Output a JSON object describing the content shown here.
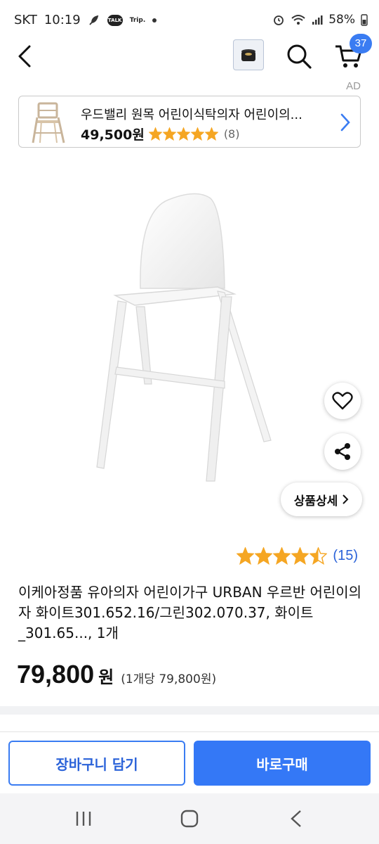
{
  "status_bar": {
    "carrier": "SKT",
    "time": "10:19",
    "talk_label": "TALK",
    "trip_label": "Trip.",
    "battery": "58%"
  },
  "header": {
    "icons": [
      "back-arrow-icon",
      "product-thumbnail",
      "search-icon",
      "cart-icon"
    ],
    "cart_count": "37"
  },
  "ad": {
    "label": "AD",
    "title": "우드밸리 원목 어린이식탁의자 어린이의...",
    "price": "49,500원",
    "rating_stars": 5,
    "review_count": "(8)"
  },
  "product": {
    "actions": {
      "like_icon": "heart-icon",
      "share_icon": "share-icon",
      "detail_label": "상품상세"
    },
    "rating": 4.5,
    "review_count": "(15)",
    "title": "이케아정품 유아의자 어린이가구 URBAN 우르반 어린이의자 화이트301.652.16/그린302.070.37, 화이트_301.65..., 1개",
    "price": "79,800",
    "price_unit": "원",
    "unit_price": "(1개당 79,800원)"
  },
  "actions": {
    "add_to_cart": "장바구니 담기",
    "buy_now": "바로구매"
  },
  "colors": {
    "accent": "#3478f6",
    "star": "#f5a623",
    "link": "#2b63d9"
  }
}
